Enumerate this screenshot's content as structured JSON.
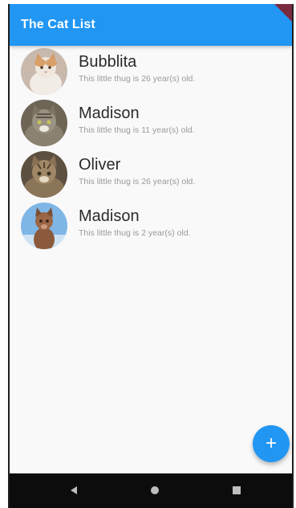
{
  "app_bar": {
    "title": "The Cat List",
    "color": "#2196f3"
  },
  "cats": [
    {
      "name": "Bubblita",
      "subtitle": "This little thug is 26 year(s) old.",
      "avatar_icon": "cat-photo-orange-white"
    },
    {
      "name": "Madison",
      "subtitle": "This little thug is 11 year(s) old.",
      "avatar_icon": "cat-photo-tabby-grey"
    },
    {
      "name": "Oliver",
      "subtitle": "This little thug is 26 year(s) old.",
      "avatar_icon": "cat-photo-tabby-brown"
    },
    {
      "name": "Madison",
      "subtitle": "This little thug is 2 year(s) old.",
      "avatar_icon": "cat-photo-brown-blue-sky"
    }
  ],
  "fab": {
    "icon": "+",
    "icon_name": "add-icon",
    "color": "#2196f3"
  },
  "nav": {
    "back_icon": "back-triangle-icon",
    "home_icon": "home-circle-icon",
    "recents_icon": "recents-square-icon"
  }
}
